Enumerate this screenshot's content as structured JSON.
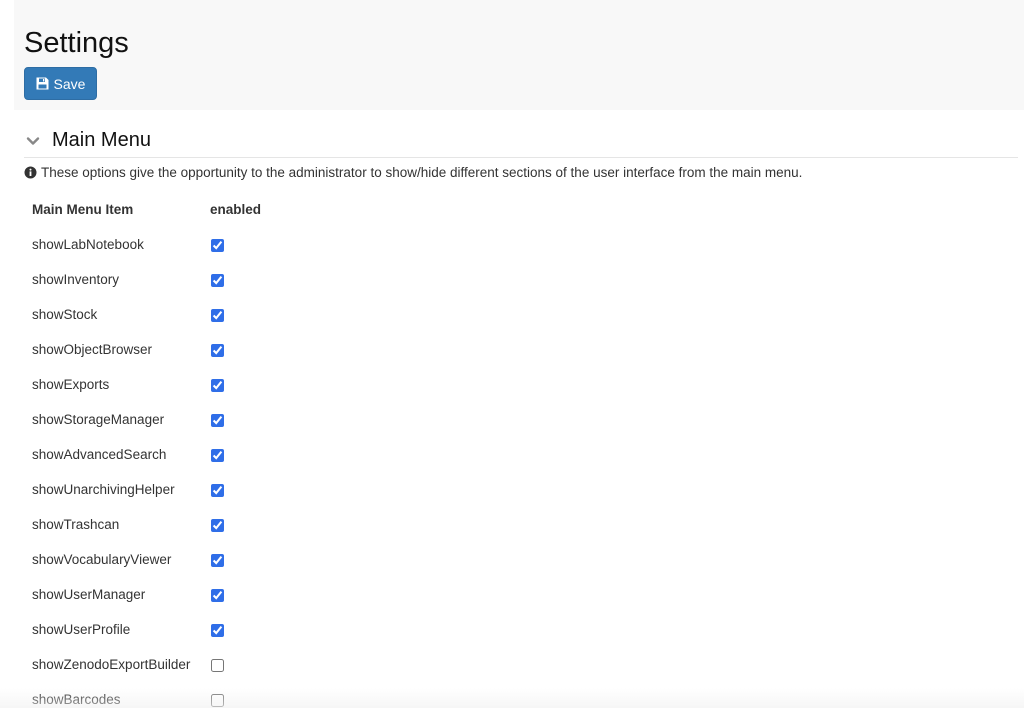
{
  "page": {
    "title": "Settings",
    "save_label": "Save"
  },
  "section": {
    "title": "Main Menu",
    "info": "These options give the opportunity to the administrator to show/hide different sections of the user interface from the main menu.",
    "columns": [
      "Main Menu Item",
      "enabled"
    ],
    "items": [
      {
        "label": "showLabNotebook",
        "enabled": true
      },
      {
        "label": "showInventory",
        "enabled": true
      },
      {
        "label": "showStock",
        "enabled": true
      },
      {
        "label": "showObjectBrowser",
        "enabled": true
      },
      {
        "label": "showExports",
        "enabled": true
      },
      {
        "label": "showStorageManager",
        "enabled": true
      },
      {
        "label": "showAdvancedSearch",
        "enabled": true
      },
      {
        "label": "showUnarchivingHelper",
        "enabled": true
      },
      {
        "label": "showTrashcan",
        "enabled": true
      },
      {
        "label": "showVocabularyViewer",
        "enabled": true
      },
      {
        "label": "showUserManager",
        "enabled": true
      },
      {
        "label": "showUserProfile",
        "enabled": true
      },
      {
        "label": "showZenodoExportBuilder",
        "enabled": false
      },
      {
        "label": "showBarcodes",
        "enabled": false
      }
    ]
  },
  "colors": {
    "primary_button": "#337ab7",
    "checkbox_accent": "#2f6ee8",
    "header_bg": "#f8f8f8"
  },
  "icons": {
    "save": "floppy-disk-icon",
    "collapse": "chevron-down-icon",
    "info": "info-circle-icon"
  }
}
